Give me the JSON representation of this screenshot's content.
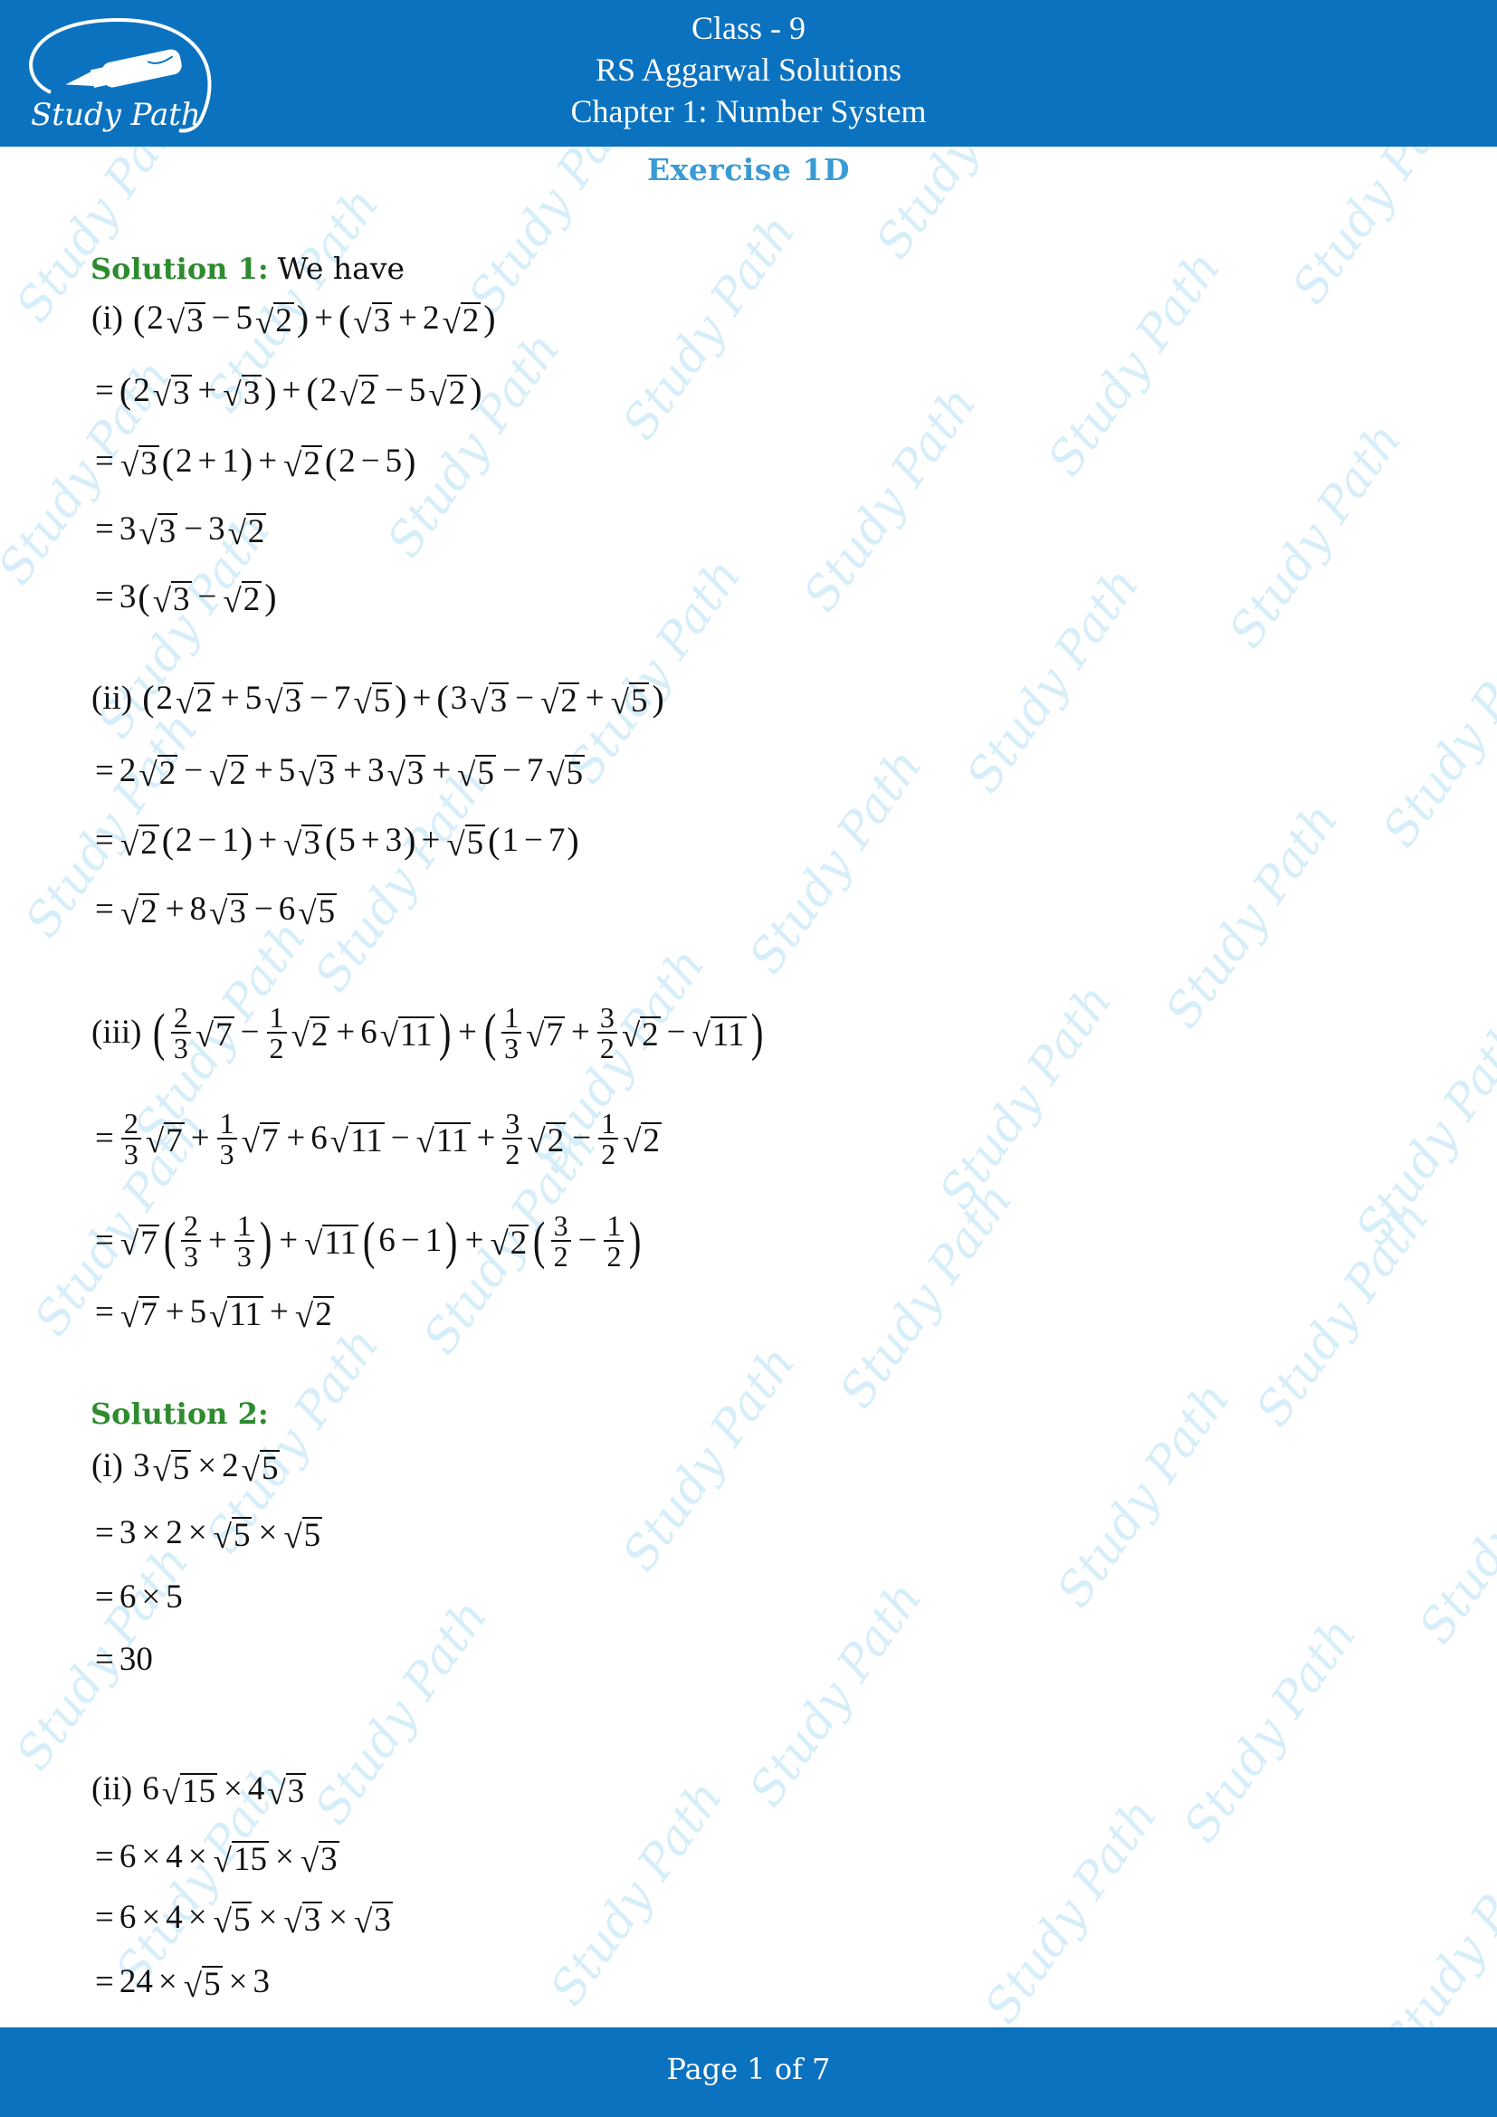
{
  "header": {
    "logo_text": "Study Path",
    "lines": [
      "Class - 9",
      "RS Aggarwal Solutions",
      "Chapter 1: Number System"
    ]
  },
  "exercise_title": "Exercise 1D",
  "watermark_text": "Study Path",
  "solutions": [
    {
      "heading": "Solution 1:",
      "intro": "We have",
      "parts": [
        {
          "label": "(i)",
          "lines": [
            "(2√3 − 5√2) + (√3 + 2√2)",
            "= (2√3 + √3) + (2√2 − 5√2)",
            "= √3(2 + 1) + √2(2 − 5)",
            "= 3√3 − 3√2",
            "= 3(√3 − √2)"
          ]
        },
        {
          "label": "(ii)",
          "lines": [
            "(2√2 + 5√3 − 7√5) + (3√3 − √2 + √5)",
            "= 2√2 − √2 + 5√3 + 3√3 + √5 − 7√5",
            "= √2(2 − 1) + √3(5 + 3) + √5(1 − 7)",
            "= √2 + 8√3 − 6√5"
          ]
        },
        {
          "label": "(iii)",
          "lines": [
            "(2/3 √7 − 1/2 √2 + 6√11) + (1/3 √7 + 3/2 √2 − √11)",
            "= 2/3 √7 + 1/3 √7 + 6√11 − √11 + 3/2 √2 − 1/2 √2",
            "= √7(2/3 + 1/3) + √11(6 − 1) + √2(3/2 − 1/2)",
            "= √7 + 5√11 + √2"
          ]
        }
      ]
    },
    {
      "heading": "Solution 2:",
      "intro": "",
      "parts": [
        {
          "label": "(i)",
          "lines": [
            "3√5 × 2√5",
            "= 3 × 2 × √5 × √5",
            "= 6 × 5",
            "= 30"
          ]
        },
        {
          "label": "(ii)",
          "lines": [
            "6√15 × 4√3",
            "= 6 × 4 × √15 × √3",
            "= 6 × 4 × √5 × √3 × √3",
            "= 24 × √5 × 3"
          ]
        }
      ]
    }
  ],
  "footer": {
    "page_text": "Page 1 of 7",
    "current_page": 1,
    "total_pages": 7
  },
  "colors": {
    "brand_blue": "#0b72c0",
    "heading_green": "#2e8b2e",
    "exercise_blue": "#3a9bd4",
    "watermark": "#d6eef9"
  }
}
